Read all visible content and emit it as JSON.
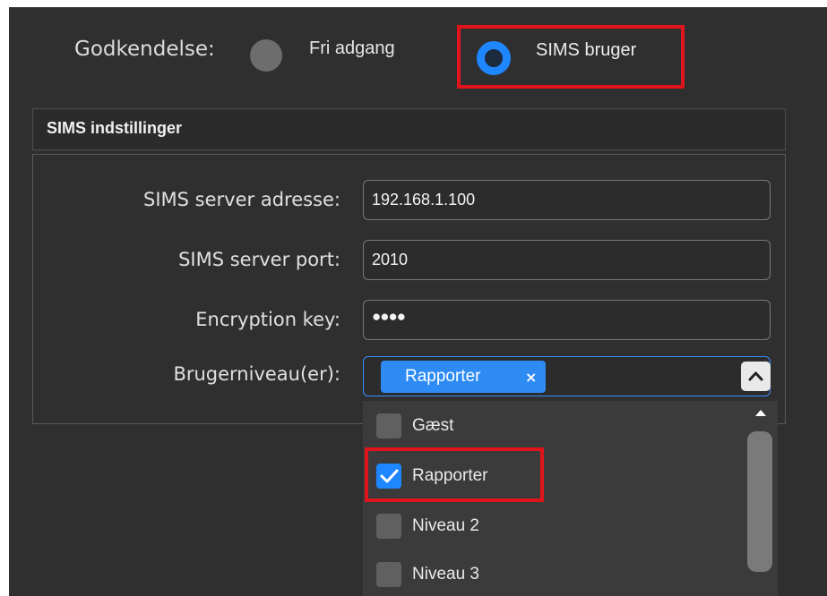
{
  "auth": {
    "label": "Godkendelse:",
    "options": [
      {
        "label": "Fri adgang",
        "selected": false
      },
      {
        "label": "SIMS bruger",
        "selected": true
      }
    ]
  },
  "section": {
    "title": "SIMS indstillinger",
    "fields": {
      "server_address": {
        "label": "SIMS server adresse:",
        "value": "192.168.1.100"
      },
      "server_port": {
        "label": "SIMS server port:",
        "value": "2010"
      },
      "encryption_key": {
        "label": "Encryption key:",
        "value": "●●●●"
      },
      "user_levels": {
        "label": "Brugerniveau(er):",
        "selected_chip": "Rapporter",
        "chip_remove": "×"
      }
    }
  },
  "dropdown": {
    "options": [
      {
        "label": "Gæst",
        "checked": false
      },
      {
        "label": "Rapporter",
        "checked": true
      },
      {
        "label": "Niveau 2",
        "checked": false
      },
      {
        "label": "Niveau 3",
        "checked": false
      }
    ]
  },
  "colors": {
    "accent": "#1e86ff",
    "highlight": "#e0141b",
    "panel": "#2f2f2f"
  }
}
